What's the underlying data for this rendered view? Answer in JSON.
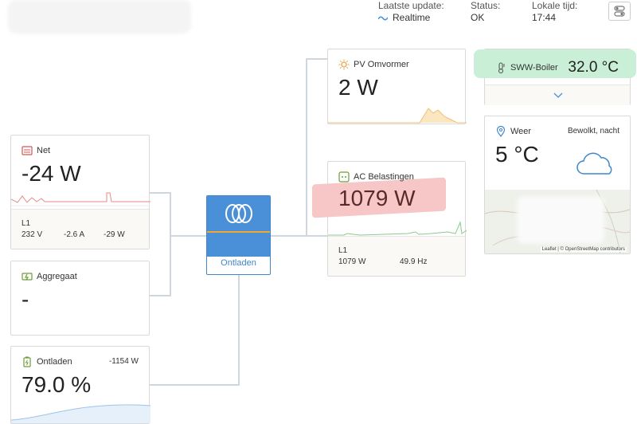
{
  "header": {
    "last_update_label": "Laatste update:",
    "last_update_value": "Realtime",
    "status_label": "Status:",
    "status_value": "OK",
    "local_time_label": "Lokale tijd:",
    "local_time_value": "17:44"
  },
  "grid": {
    "title": "Net",
    "power": "-24 W",
    "phase": "L1",
    "voltage": "232 V",
    "current": "-2.6 A",
    "phase_power": "-29 W"
  },
  "generator": {
    "title": "Aggregaat",
    "value": "-"
  },
  "battery": {
    "title": "Ontladen",
    "power": "-1154 W",
    "soc": "79.0 %"
  },
  "inverter": {
    "label": "Ontladen"
  },
  "pv": {
    "title": "PV Omvormer",
    "power": "2 W"
  },
  "ac_loads": {
    "title": "AC Belastingen",
    "power": "1079 W",
    "phase": "L1",
    "phase_power": "1079 W",
    "frequency": "49.9 Hz"
  },
  "boiler": {
    "title": "SWW-Boiler",
    "temperature": "32.0 °C"
  },
  "weather": {
    "title": "Weer",
    "condition": "Bewolkt, nacht",
    "temperature": "5 °C",
    "map_attribution": "Leaflet | © OpenStreetMap contributors"
  },
  "colors": {
    "accent_blue": "#4a90d9",
    "inverter_stripe": "#f0a830",
    "grid_sparkline": "#e88a8a",
    "ac_sparkline": "#8cc98c",
    "pv_sparkline": "#f0c070",
    "battery_sparkline": "#9cc4e8"
  }
}
